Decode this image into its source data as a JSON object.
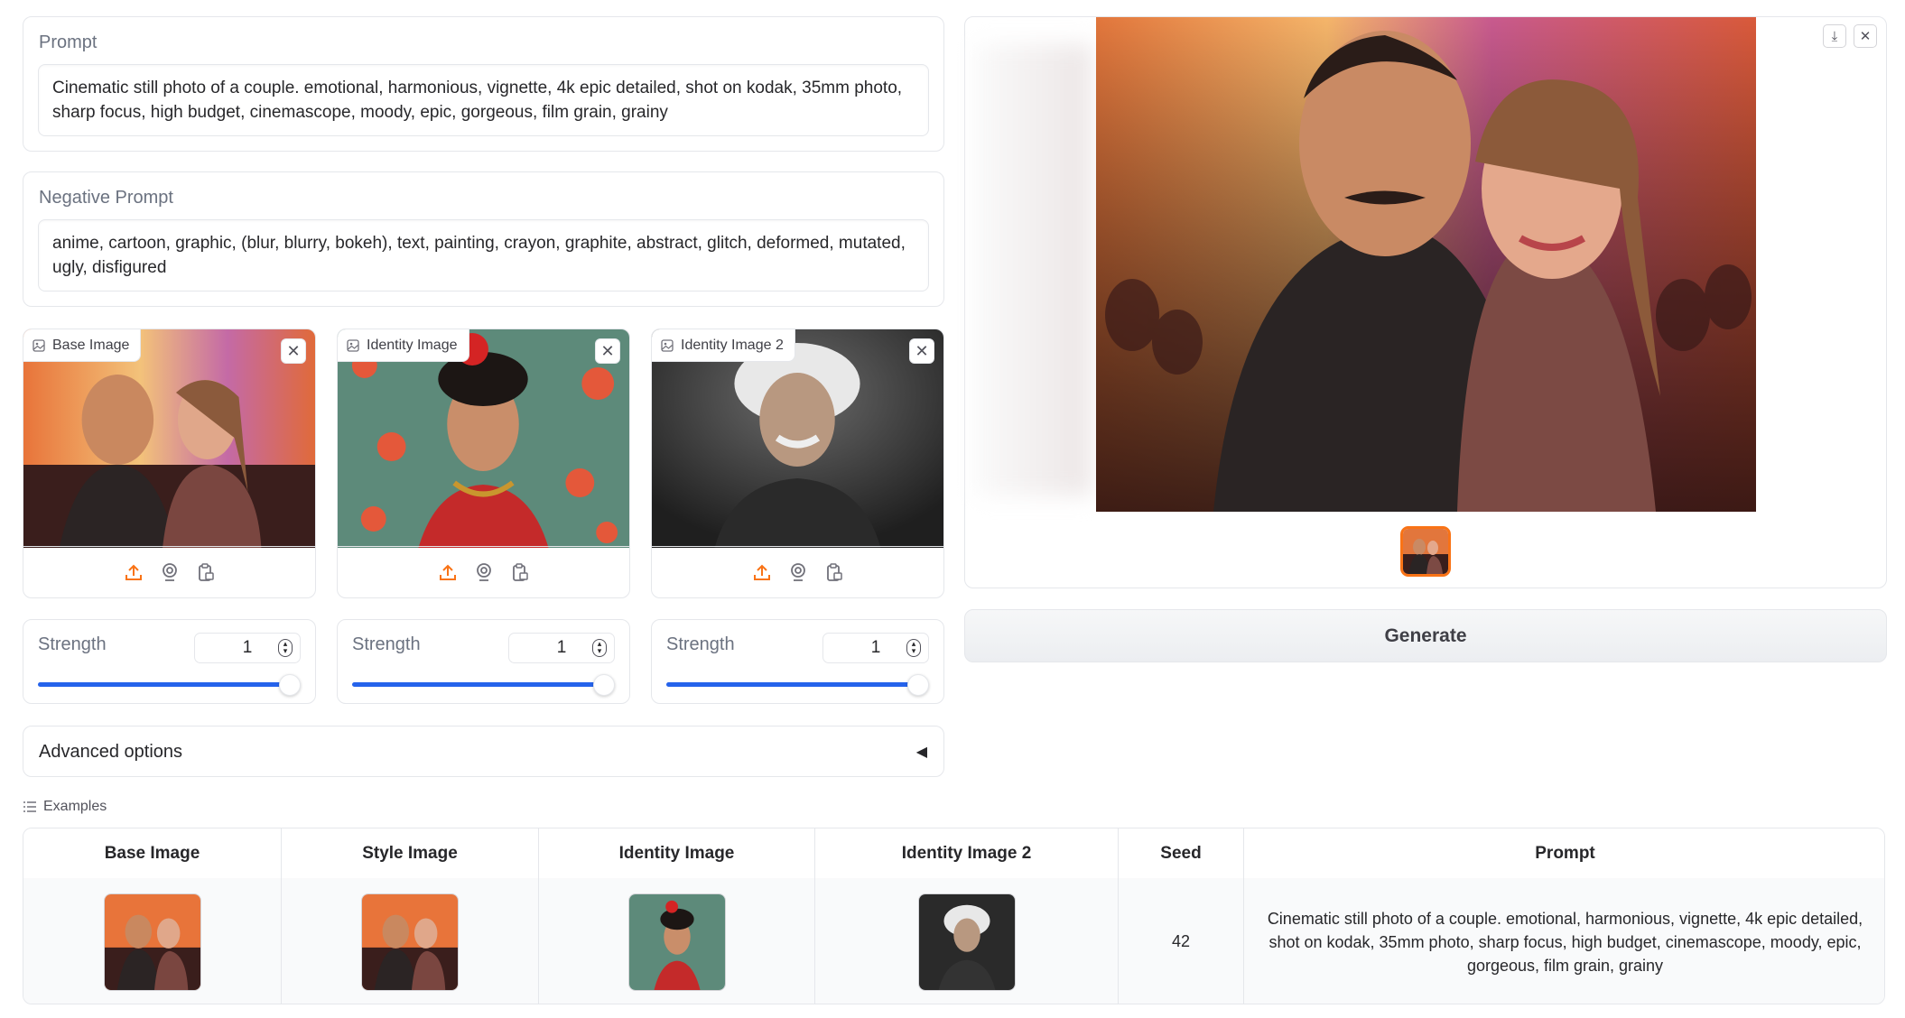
{
  "prompt": {
    "label": "Prompt",
    "value": "Cinematic still photo of a couple. emotional, harmonious, vignette, 4k epic detailed, shot on kodak, 35mm photo, sharp focus, high budget, cinemascope, moody, epic, gorgeous, film grain, grainy"
  },
  "negative_prompt": {
    "label": "Negative Prompt",
    "value": "anime, cartoon, graphic, (blur, blurry, bokeh), text, painting, crayon, graphite, abstract, glitch, deformed, mutated, ugly, disfigured"
  },
  "image_inputs": [
    {
      "label": "Base Image",
      "icon": "image-icon"
    },
    {
      "label": "Identity Image",
      "icon": "image-icon"
    },
    {
      "label": "Identity Image 2",
      "icon": "image-icon"
    }
  ],
  "strengths": [
    {
      "label": "Strength",
      "value": "1",
      "level": 1.0
    },
    {
      "label": "Strength",
      "value": "1",
      "level": 1.0
    },
    {
      "label": "Strength",
      "value": "1",
      "level": 1.0
    }
  ],
  "advanced": {
    "label": "Advanced options",
    "arrow": "◀"
  },
  "examples": {
    "label": "Examples",
    "headers": [
      "Base Image",
      "Style Image",
      "Identity Image",
      "Identity Image 2",
      "Seed",
      "Prompt"
    ],
    "row": {
      "seed": "42",
      "prompt": "Cinematic still photo of a couple. emotional, harmonious, vignette, 4k epic detailed, shot on kodak, 35mm photo, sharp focus, high budget, cinemascope, moody, epic, gorgeous, film grain, grainy"
    }
  },
  "generate": {
    "label": "Generate"
  },
  "colors": {
    "accent": "#f97316",
    "slider": "#2563eb"
  }
}
